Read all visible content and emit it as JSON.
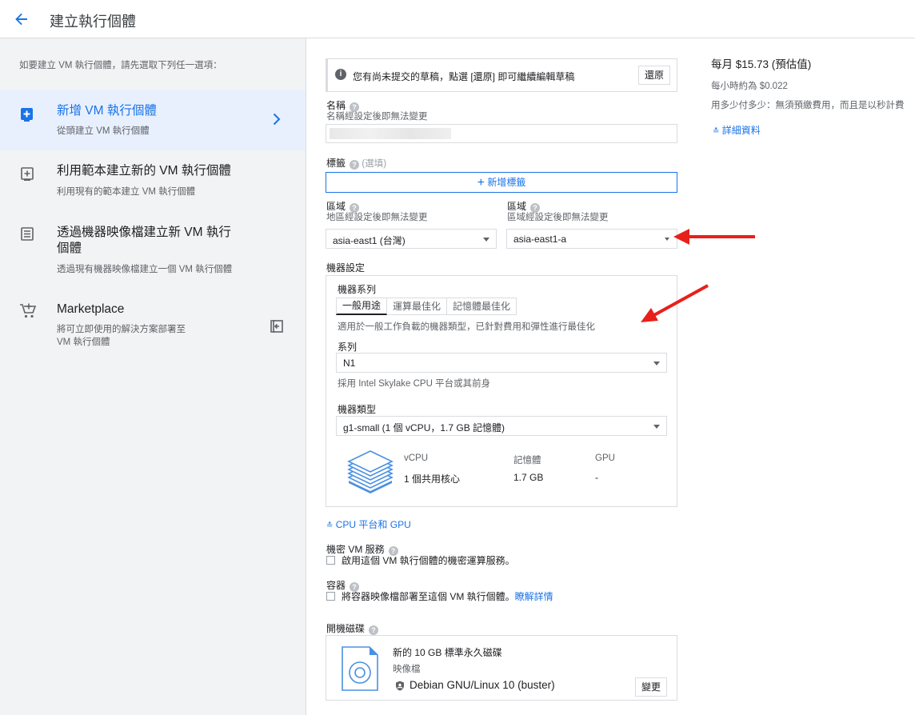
{
  "header": {
    "title": "建立執行個體"
  },
  "left": {
    "intro": "如要建立 VM 執行個體，請先選取下列任一選項：",
    "options": [
      {
        "title": "新增 VM 執行個體",
        "subtitle": "從頭建立 VM 執行個體"
      },
      {
        "title": "利用範本建立新的 VM 執行個體",
        "subtitle": "利用現有的範本建立 VM 執行個體"
      },
      {
        "title_line1": "透過機器映像檔建立新 VM 執行",
        "title_line2": "個體",
        "subtitle": "透過現有機器映像檔建立一個 VM 執行個體"
      },
      {
        "title": "Marketplace",
        "subtitle_line1": "將可立即使用的解決方案部署至",
        "subtitle_line2": "VM 執行個體"
      }
    ]
  },
  "draft": {
    "message": "您有尚未提交的草稿，點選 [還原] 即可繼續編輯草稿",
    "restore": "還原"
  },
  "name": {
    "label": "名稱",
    "hint": "名稱經設定後即無法變更"
  },
  "labels": {
    "label": "標籤",
    "optional": "(選填)",
    "add": "新增標籤"
  },
  "region": {
    "label": "區域",
    "hint": "地區經設定後即無法變更",
    "value": "asia-east1 (台灣)"
  },
  "zone": {
    "label": "區域",
    "hint": "區域經設定後即無法變更",
    "value": "asia-east1-a"
  },
  "machine": {
    "section": "機器設定",
    "family_label": "機器系列",
    "tabs": [
      "一般用途",
      "運算最佳化",
      "記憶體最佳化"
    ],
    "family_desc": "適用於一般工作負載的機器類型，已針對費用和彈性進行最佳化",
    "series_label": "系列",
    "series_value": "N1",
    "series_desc": "採用 Intel Skylake CPU 平台或其前身",
    "type_label": "機器類型",
    "type_value": "g1-small (1 個 vCPU，1.7 GB 記憶體)",
    "specs": {
      "vcpu_h": "vCPU",
      "mem_h": "記憶體",
      "gpu_h": "GPU",
      "vcpu_v": "1 個共用核心",
      "mem_v": "1.7 GB",
      "gpu_v": "-"
    }
  },
  "cpu_gpu": "CPU 平台和 GPU",
  "confidential": {
    "label": "機密 VM 服務",
    "check": "啟用這個 VM 執行個體的機密運算服務。"
  },
  "container": {
    "label": "容器",
    "check": "將容器映像檔部署至這個 VM 執行個體。",
    "learn": "瞭解詳情"
  },
  "boot": {
    "label": "開機磁碟",
    "disk": "新的 10 GB 標準永久磁碟",
    "image_label": "映像檔",
    "image": "Debian GNU/Linux 10 (buster)",
    "change": "變更"
  },
  "pricing": {
    "monthly": "每月 $15.73 (預估值)",
    "hourly": "每小時約為 $0.022",
    "note": "用多少付多少：無須預繳費用，而且是以秒計費",
    "details": "詳細資料"
  },
  "colors": {
    "accent": "#1a73e8",
    "annotation": "#e8201a"
  }
}
